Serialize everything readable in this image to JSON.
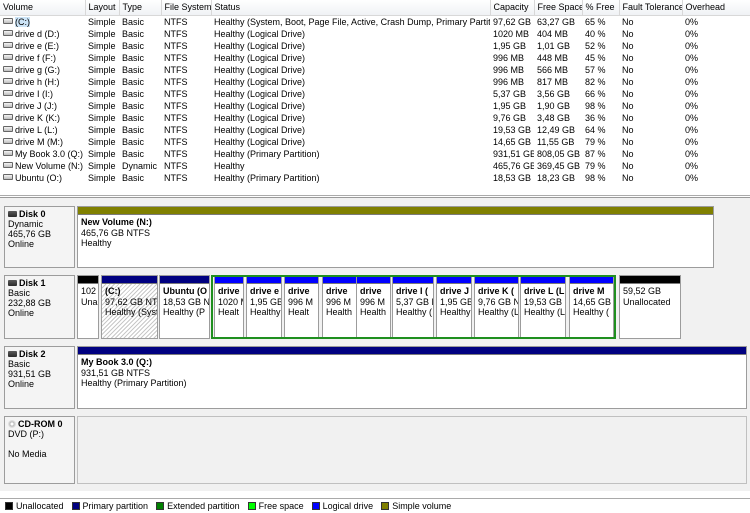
{
  "table": {
    "headers": [
      "Volume",
      "Layout",
      "Type",
      "File System",
      "Status",
      "Capacity",
      "Free Space",
      "% Free",
      "Fault Tolerance",
      "Overhead"
    ],
    "rows": [
      [
        "(C:)",
        "Simple",
        "Basic",
        "NTFS",
        "Healthy (System, Boot, Page File, Active, Crash Dump, Primary Partition)",
        "97,62 GB",
        "63,27 GB",
        "65 %",
        "No",
        "0%"
      ],
      [
        "drive d (D:)",
        "Simple",
        "Basic",
        "NTFS",
        "Healthy (Logical Drive)",
        "1020 MB",
        "404 MB",
        "40 %",
        "No",
        "0%"
      ],
      [
        "drive e (E:)",
        "Simple",
        "Basic",
        "NTFS",
        "Healthy (Logical Drive)",
        "1,95 GB",
        "1,01 GB",
        "52 %",
        "No",
        "0%"
      ],
      [
        "drive f (F:)",
        "Simple",
        "Basic",
        "NTFS",
        "Healthy (Logical Drive)",
        "996 MB",
        "448 MB",
        "45 %",
        "No",
        "0%"
      ],
      [
        "drive g (G:)",
        "Simple",
        "Basic",
        "NTFS",
        "Healthy (Logical Drive)",
        "996 MB",
        "566 MB",
        "57 %",
        "No",
        "0%"
      ],
      [
        "drive h (H:)",
        "Simple",
        "Basic",
        "NTFS",
        "Healthy (Logical Drive)",
        "996 MB",
        "817 MB",
        "82 %",
        "No",
        "0%"
      ],
      [
        "drive I (I:)",
        "Simple",
        "Basic",
        "NTFS",
        "Healthy (Logical Drive)",
        "5,37 GB",
        "3,56 GB",
        "66 %",
        "No",
        "0%"
      ],
      [
        "drive J (J:)",
        "Simple",
        "Basic",
        "NTFS",
        "Healthy (Logical Drive)",
        "1,95 GB",
        "1,90 GB",
        "98 %",
        "No",
        "0%"
      ],
      [
        "drive K (K:)",
        "Simple",
        "Basic",
        "NTFS",
        "Healthy (Logical Drive)",
        "9,76 GB",
        "3,48 GB",
        "36 %",
        "No",
        "0%"
      ],
      [
        "drive L (L:)",
        "Simple",
        "Basic",
        "NTFS",
        "Healthy (Logical Drive)",
        "19,53 GB",
        "12,49 GB",
        "64 %",
        "No",
        "0%"
      ],
      [
        "drive M (M:)",
        "Simple",
        "Basic",
        "NTFS",
        "Healthy (Logical Drive)",
        "14,65 GB",
        "11,55 GB",
        "79 %",
        "No",
        "0%"
      ],
      [
        "My Book 3.0 (Q:)",
        "Simple",
        "Basic",
        "NTFS",
        "Healthy (Primary Partition)",
        "931,51 GB",
        "808,05 GB",
        "87 %",
        "No",
        "0%"
      ],
      [
        "New Volume (N:)",
        "Simple",
        "Dynamic",
        "NTFS",
        "Healthy",
        "465,76 GB",
        "369,45 GB",
        "79 %",
        "No",
        "0%"
      ],
      [
        "Ubuntu (O:)",
        "Simple",
        "Basic",
        "NTFS",
        "Healthy (Primary Partition)",
        "18,53 GB",
        "18,23 GB",
        "98 %",
        "No",
        "0%"
      ]
    ]
  },
  "disks": {
    "disk0": {
      "name": "Disk 0",
      "type": "Dynamic",
      "size": "465,76 GB",
      "status": "Online",
      "partitions": [
        {
          "lbl": "New Volume  (N:)",
          "l2": "465,76 GB NTFS",
          "l3": "Healthy",
          "color": "#808000"
        }
      ]
    },
    "disk1": {
      "name": "Disk 1",
      "type": "Basic",
      "size": "232,88 GB",
      "status": "Online",
      "partitions": [
        {
          "lbl": "",
          "l2": "102",
          "l3": "Una",
          "color": "#000000"
        },
        {
          "lbl": "(C:)",
          "l2": "97,62 GB NTFS",
          "l3": "Healthy (Syst",
          "color": "#000080"
        },
        {
          "lbl": "Ubuntu  (O",
          "l2": "18,53 GB NTF",
          "l3": "Healthy (P",
          "color": "#000080"
        },
        {
          "lbl": "drive",
          "l2": "1020 M",
          "l3": "Healt",
          "color": "#0000ff"
        },
        {
          "lbl": "drive e",
          "l2": "1,95 GB",
          "l3": "Healthy",
          "color": "#0000ff"
        },
        {
          "lbl": "drive",
          "l2": "996 M",
          "l3": "Healt",
          "color": "#0000ff"
        },
        {
          "lbl": "drive",
          "l2": "996 M",
          "l3": "Health",
          "color": "#0000ff"
        },
        {
          "lbl": "drive",
          "l2": "996 M",
          "l3": "Health",
          "color": "#0000ff"
        },
        {
          "lbl": "drive I  (",
          "l2": "5,37 GB N",
          "l3": "Healthy (",
          "color": "#0000ff"
        },
        {
          "lbl": "drive J",
          "l2": "1,95 GB",
          "l3": "Healthy",
          "color": "#0000ff"
        },
        {
          "lbl": "drive K  (",
          "l2": "9,76 GB N",
          "l3": "Healthy (L",
          "color": "#0000ff"
        },
        {
          "lbl": "drive L  (L",
          "l2": "19,53 GB N",
          "l3": "Healthy (L",
          "color": "#0000ff"
        },
        {
          "lbl": "drive M",
          "l2": "14,65 GB",
          "l3": "Healthy (",
          "color": "#0000ff"
        },
        {
          "lbl": "",
          "l2": "59,52 GB",
          "l3": "Unallocated",
          "color": "#000000"
        }
      ]
    },
    "disk2": {
      "name": "Disk 2",
      "type": "Basic",
      "size": "931,51 GB",
      "status": "Online",
      "partitions": [
        {
          "lbl": "My Book 3.0  (Q:)",
          "l2": "931,51 GB NTFS",
          "l3": "Healthy (Primary Partition)",
          "color": "#000080"
        }
      ]
    },
    "cdrom0": {
      "name": "CD-ROM 0",
      "type": "DVD (P:)",
      "size": "",
      "status": "No Media"
    }
  },
  "legend": [
    {
      "label": "Unallocated",
      "color": "#000000"
    },
    {
      "label": "Primary partition",
      "color": "#000080"
    },
    {
      "label": "Extended partition",
      "color": "#008000"
    },
    {
      "label": "Free space",
      "color": "#00ff00"
    },
    {
      "label": "Logical drive",
      "color": "#0000ff"
    },
    {
      "label": "Simple volume",
      "color": "#808000"
    }
  ]
}
